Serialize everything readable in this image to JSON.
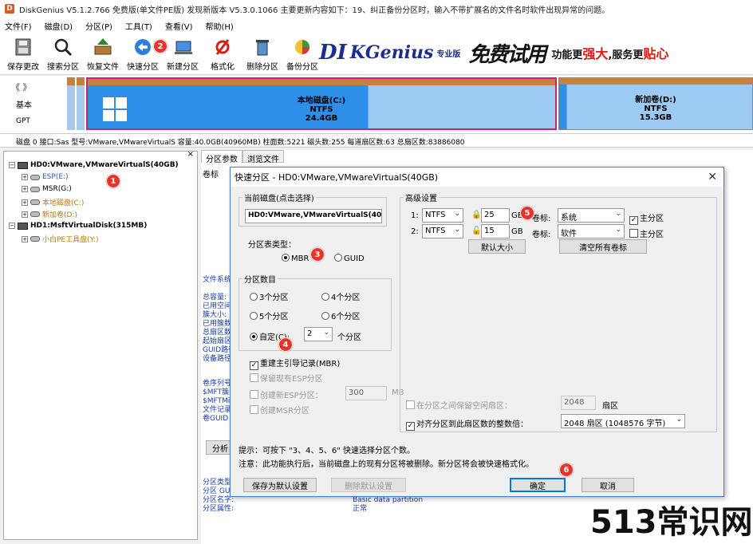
{
  "app": {
    "title": "DiskGenius V5.1.2.766 免费版(单文件PE版)   发现新版本 V5.3.0.1066 主要更新内容如下：19、纠正备份分区时，输入不带扩展名的文件名时软件出现异常的问题。"
  },
  "menu": [
    "文件(F)",
    "磁盘(D)",
    "分区(P)",
    "工具(T)",
    "查看(V)",
    "帮助(H)"
  ],
  "toolbar": [
    {
      "label": "保存更改",
      "icon": "save-icon"
    },
    {
      "label": "搜索分区",
      "icon": "search-icon"
    },
    {
      "label": "恢复文件",
      "icon": "recover-icon"
    },
    {
      "label": "快速分区",
      "icon": "quick-partition-icon"
    },
    {
      "label": "新建分区",
      "icon": "new-partition-icon"
    },
    {
      "label": "格式化",
      "icon": "format-icon"
    },
    {
      "label": "删除分区",
      "icon": "delete-icon"
    },
    {
      "label": "备份分区",
      "icon": "backup-icon"
    }
  ],
  "banner": {
    "brand1": "DI",
    "brand2": "KGenius",
    "edition": "专业版",
    "free": "免费试用",
    "slogan_a": "功能更",
    "slogan_b": "强大",
    "slogan_c": "服务更",
    "slogan_d": "贴心"
  },
  "disk_map": {
    "type1": "基本",
    "type2": "GPT",
    "nav": "《 》",
    "partitions": [
      {
        "name": "本地磁盘(C:)",
        "fs": "NTFS",
        "size": "24.4GB"
      },
      {
        "name": "新加卷(D:)",
        "fs": "NTFS",
        "size": "15.3GB"
      }
    ]
  },
  "disk_info": "磁盘 0 接口:Sas  型号:VMware,VMwareVirtualS  容量:40.0GB(40960MB)  柱面数:5221  磁头数:255  每道扇区数:63  总扇区数:83886080",
  "tree": [
    {
      "label": "HD0:VMware,VMwareVirtualS(40GB)",
      "color": "#000000",
      "kind": "disk"
    },
    {
      "label": "ESP(E:)",
      "color": "#2a55c0",
      "kind": "vol"
    },
    {
      "label": "MSR(G:)",
      "color": "#000000",
      "kind": "vol"
    },
    {
      "label": "本地磁盘(C:)",
      "color": "#c07a00",
      "kind": "vol"
    },
    {
      "label": "新加卷(D:)",
      "color": "#c07a00",
      "kind": "vol"
    },
    {
      "label": "HD1:MsftVirtualDisk(315MB)",
      "color": "#000000",
      "kind": "disk"
    },
    {
      "label": "小白PE工具盘(Y:)",
      "color": "#c07a00",
      "kind": "vol"
    }
  ],
  "right_panel": {
    "tabs": [
      "分区参数",
      "浏览文件"
    ],
    "col_label": "卷标",
    "side_block1": "文件系统\n\n总容量:\n已用空间\n簇大小:\n已用簇数\n总扇区数\n起始扇区\nGUID路径\n设备路径",
    "side_block2": "卷序列号\n$MFT簇号\n$MFTMirr\n文件记录\n卷GUID",
    "analyze_btn": "分析",
    "bottom_labels": "分区类型\n分区 GU\n分区名字:\n分区属性:",
    "bottom_values": "Basic data partition\n正常"
  },
  "dialog": {
    "title": "快速分区 - HD0:VMware,VMwareVirtualS(40GB)",
    "current_disk_legend": "当前磁盘(点击选择)",
    "current_disk": "HD0:VMware,VMwareVirtualS(40",
    "table_type_label": "分区表类型：",
    "mbr": "MBR",
    "guid": "GUID",
    "count_legend": "分区数目",
    "count_options": [
      "3个分区",
      "4个分区",
      "5个分区",
      "6个分区"
    ],
    "custom_label": "自定(C):",
    "custom_value": "2",
    "custom_unit": "个分区",
    "rebuild_mbr": "重建主引导记录(MBR)",
    "keep_esp": "保留现有ESP分区",
    "create_esp": "创建新ESP分区：",
    "esp_size": "300",
    "esp_unit": "MB",
    "create_msr": "创建MSR分区",
    "adv_legend": "高级设置",
    "rows": [
      {
        "idx": "1:",
        "fs": "NTFS",
        "size": "25",
        "unit": "GB",
        "vol_label_prefix": "卷标:",
        "vol_label": "系统",
        "primary": "主分区",
        "primary_checked": "✓"
      },
      {
        "idx": "2:",
        "fs": "NTFS",
        "size": "15",
        "unit": "GB",
        "vol_label_prefix": "卷标:",
        "vol_label": "软件",
        "primary": "主分区",
        "primary_checked": ""
      }
    ],
    "default_size_btn": "默认大小",
    "clear_labels_btn": "清空所有卷标",
    "keep_free": "在分区之间保留空闲扇区：",
    "keep_free_value": "2048",
    "keep_free_unit": "扇区",
    "align": "对齐分区到此扇区数的整数倍：",
    "align_value": "2048 扇区 (1048576 字节)",
    "tip1": "提示：可按下 \"3、4、5、6\" 快速选择分区个数。",
    "tip2": "注意：此功能执行后，当前磁盘上的现有分区将被删除。新分区将会被快速格式化。",
    "save_default_btn": "保存为默认设置",
    "delete_default_btn": "删除默认设置",
    "ok_btn": "确定",
    "cancel_btn": "取消"
  },
  "badges": [
    "1",
    "2",
    "3",
    "4",
    "5",
    "6"
  ],
  "watermark": "513常识网"
}
